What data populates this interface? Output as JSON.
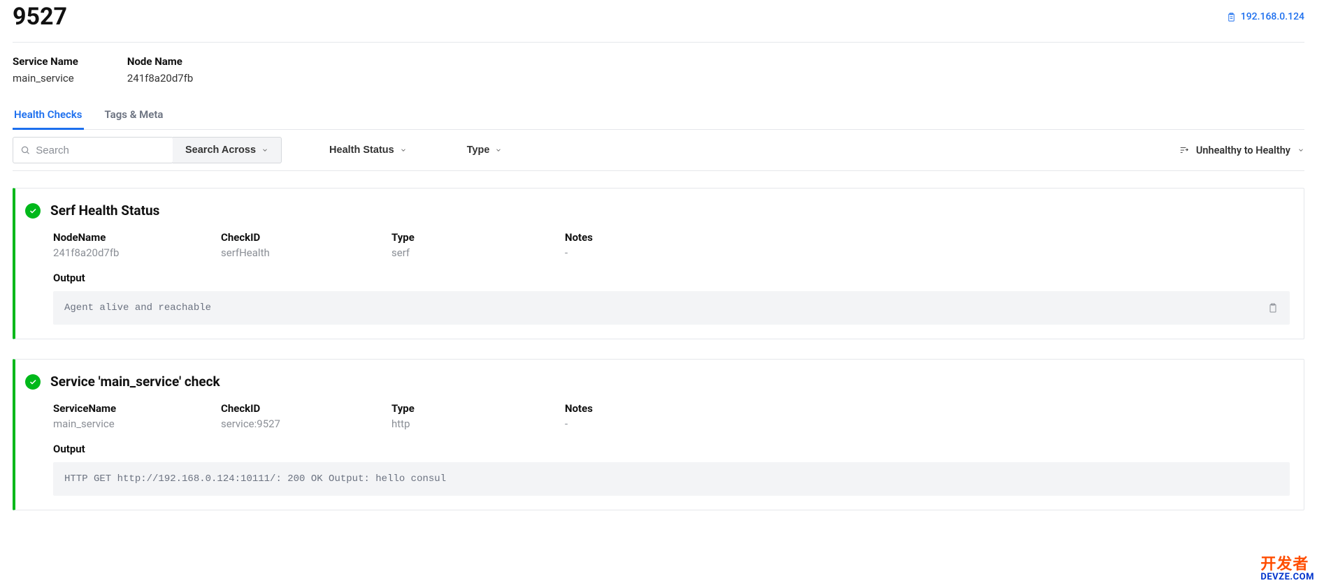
{
  "header": {
    "title": "9527",
    "ip_link": "192.168.0.124"
  },
  "meta": {
    "service_name_label": "Service Name",
    "service_name_value": "main_service",
    "node_name_label": "Node Name",
    "node_name_value": "241f8a20d7fb"
  },
  "tabs": {
    "health_checks": "Health Checks",
    "tags_meta": "Tags & Meta"
  },
  "filters": {
    "search_placeholder": "Search",
    "search_across": "Search Across",
    "health_status": "Health Status",
    "type": "Type",
    "sort": "Unhealthy to Healthy"
  },
  "checks": [
    {
      "title": "Serf Health Status",
      "cols": {
        "col1_label": "NodeName",
        "col1_value": "241f8a20d7fb",
        "col2_label": "CheckID",
        "col2_value": "serfHealth",
        "col3_label": "Type",
        "col3_value": "serf",
        "col4_label": "Notes",
        "col4_value": "-"
      },
      "output_label": "Output",
      "output_text": "Agent alive and reachable"
    },
    {
      "title": "Service 'main_service' check",
      "cols": {
        "col1_label": "ServiceName",
        "col1_value": "main_service",
        "col2_label": "CheckID",
        "col2_value": "service:9527",
        "col3_label": "Type",
        "col3_value": "http",
        "col4_label": "Notes",
        "col4_value": "-"
      },
      "output_label": "Output",
      "output_text": "HTTP GET http://192.168.0.124:10111/: 200 OK Output: hello consul"
    }
  ],
  "watermark": {
    "top": "开发者",
    "bot": "DEVZE.COM"
  }
}
